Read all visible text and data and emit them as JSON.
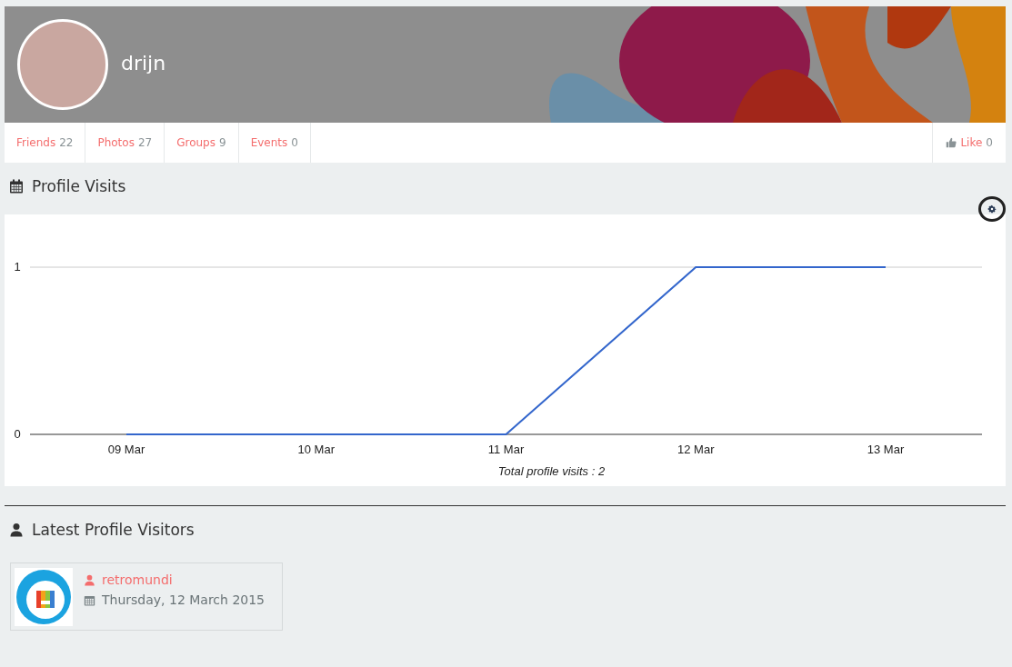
{
  "profile": {
    "name": "drijn"
  },
  "tabs": [
    {
      "label": "Friends",
      "count": "22"
    },
    {
      "label": "Photos",
      "count": "27"
    },
    {
      "label": "Groups",
      "count": "9"
    },
    {
      "label": "Events",
      "count": "0"
    }
  ],
  "like": {
    "label": "Like",
    "count": "0"
  },
  "visits": {
    "title": "Profile Visits",
    "chart_data": {
      "type": "line",
      "xlabel": "Total profile visits : 2",
      "categories": [
        "09 Mar",
        "10 Mar",
        "11 Mar",
        "12 Mar",
        "13 Mar"
      ],
      "series": [
        {
          "color": "#3366cc",
          "values": [
            0,
            0,
            0,
            1,
            1
          ]
        }
      ],
      "ylim": [
        0,
        1
      ],
      "yticks": [
        0,
        1
      ]
    }
  },
  "visitors": {
    "title": "Latest Profile Visitors",
    "items": [
      {
        "name": "retromundi",
        "date": "Thursday, 12 March 2015"
      }
    ]
  }
}
